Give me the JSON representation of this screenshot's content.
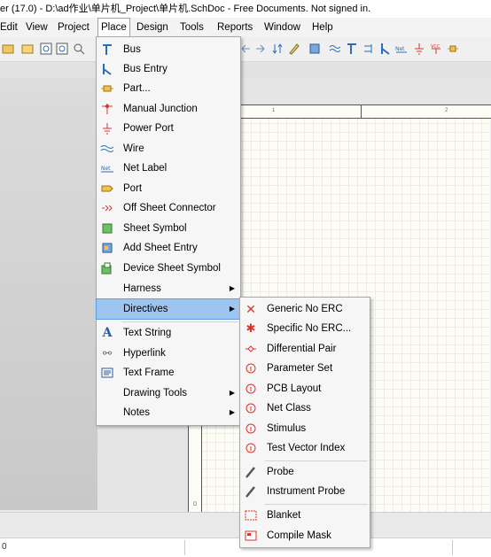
{
  "title": "er (17.0) - D:\\ad作业\\单片机_Project\\单片机.SchDoc - Free Documents. Not signed in.",
  "menubar": [
    {
      "label": "Edit",
      "mn": "E"
    },
    {
      "label": "View",
      "mn": "V"
    },
    {
      "label": "Project",
      "mn": "c"
    },
    {
      "label": "Place",
      "mn": "P"
    },
    {
      "label": "Design",
      "mn": "D"
    },
    {
      "label": "Tools",
      "mn": "T"
    },
    {
      "label": "Reports",
      "mn": "R"
    },
    {
      "label": "Window",
      "mn": "W"
    },
    {
      "label": "Help",
      "mn": "H"
    }
  ],
  "place_menu": [
    {
      "label": "Bus",
      "icon": "bus-icon"
    },
    {
      "label": "Bus Entry",
      "icon": "bus-entry-icon"
    },
    {
      "label": "Part...",
      "icon": "part-icon"
    },
    {
      "label": "Manual Junction",
      "icon": "junction-icon"
    },
    {
      "label": "Power Port",
      "icon": "power-port-icon"
    },
    {
      "label": "Wire",
      "icon": "wire-icon"
    },
    {
      "label": "Net Label",
      "icon": "net-label-icon"
    },
    {
      "label": "Port",
      "icon": "port-icon"
    },
    {
      "label": "Off Sheet Connector",
      "icon": "off-sheet-connector-icon"
    },
    {
      "label": "Sheet Symbol",
      "icon": "sheet-symbol-icon"
    },
    {
      "label": "Add Sheet Entry",
      "icon": "sheet-entry-icon"
    },
    {
      "label": "Device Sheet Symbol",
      "icon": "device-sheet-icon"
    },
    {
      "label": "Harness",
      "icon": "",
      "submenu": true
    },
    {
      "label": "Directives",
      "icon": "",
      "submenu": true,
      "highlighted": true
    },
    {
      "label": "Text String",
      "icon": "text-string-icon"
    },
    {
      "label": "Hyperlink",
      "icon": "hyperlink-icon"
    },
    {
      "label": "Text Frame",
      "icon": "text-frame-icon"
    },
    {
      "label": "Drawing Tools",
      "icon": "",
      "submenu": true
    },
    {
      "label": "Notes",
      "icon": "",
      "submenu": true
    }
  ],
  "directives_menu": [
    {
      "label": "Generic No ERC",
      "icon": "no-erc-icon"
    },
    {
      "label": "Specific No ERC...",
      "icon": "specific-no-erc-icon"
    },
    {
      "label": "Differential Pair",
      "icon": "diff-pair-icon"
    },
    {
      "label": "Parameter Set",
      "icon": "parameter-set-icon"
    },
    {
      "label": "PCB Layout",
      "icon": "pcb-layout-icon"
    },
    {
      "label": "Net Class",
      "icon": "net-class-icon"
    },
    {
      "label": "Stimulus",
      "icon": "stimulus-icon"
    },
    {
      "label": "Test Vector Index",
      "icon": "test-vector-icon"
    },
    {
      "label": "Probe",
      "icon": "probe-icon"
    },
    {
      "label": "Instrument Probe",
      "icon": "instrument-probe-icon"
    },
    {
      "label": "Blanket",
      "icon": "blanket-icon"
    },
    {
      "label": "Compile Mask",
      "icon": "compile-mask-icon"
    }
  ],
  "sheet_zones": {
    "col1": "1",
    "col2": "2",
    "rowD": "D"
  },
  "status": {
    "coord": "0"
  }
}
